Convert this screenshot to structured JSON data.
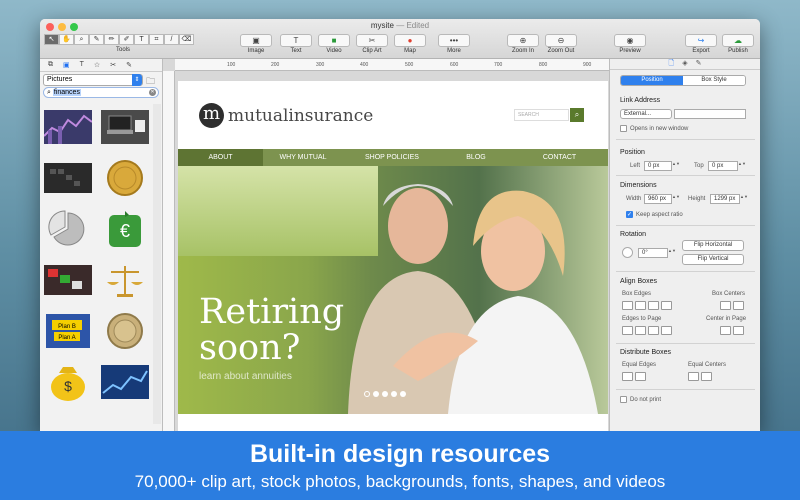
{
  "window": {
    "title": "mysite",
    "edited": "— Edited",
    "traffic_lights": [
      "#fc605b",
      "#fdbc40",
      "#34c84a"
    ]
  },
  "toolbar": {
    "tools_label": "Tools",
    "buttons": [
      {
        "label": "Image",
        "icon": "image-icon"
      },
      {
        "label": "Text",
        "icon": "text-icon"
      },
      {
        "label": "Video",
        "icon": "video-icon"
      },
      {
        "label": "Clip Art",
        "icon": "clipart-icon"
      },
      {
        "label": "Map",
        "icon": "map-pin-icon"
      },
      {
        "label": "More",
        "icon": "more-icon"
      },
      {
        "label": "Zoom In",
        "icon": "zoom-in-icon"
      },
      {
        "label": "Zoom Out",
        "icon": "zoom-out-icon"
      },
      {
        "label": "Preview",
        "icon": "eye-icon"
      },
      {
        "label": "Export",
        "icon": "export-icon"
      },
      {
        "label": "Publish",
        "icon": "publish-icon"
      }
    ]
  },
  "library": {
    "category": "Pictures",
    "search_value": "finances",
    "items": [
      "stock-chart",
      "laptop-desk",
      "calculator-keys",
      "gold-coin",
      "pie-chart-3d",
      "euro-safe",
      "typewriter-keys",
      "golden-scales",
      "plan-b-sign",
      "silver-coin",
      "profit-money-bag",
      "stock-arrow"
    ]
  },
  "ruler": {
    "labels": [
      "100",
      "200",
      "300",
      "400",
      "500",
      "600",
      "700",
      "800",
      "900"
    ]
  },
  "site": {
    "logo_letter": "m",
    "logo_bold": "mutual",
    "logo_rest": "insurance",
    "search_placeholder": "SEARCH",
    "nav": [
      "ABOUT",
      "WHY MUTUAL",
      "SHOP POLICIES",
      "BLOG",
      "CONTACT"
    ],
    "hero_title_1": "Retiring",
    "hero_title_2": "soon?",
    "hero_sub": "learn about annuities",
    "slide_active_index": 0,
    "slide_count": 5
  },
  "inspector": {
    "tab_position": "Position",
    "tab_box_style": "Box Style",
    "link_address": "Link Address",
    "link_type": "External...",
    "open_new_window": "Opens in new window",
    "position": "Position",
    "left_label": "Left",
    "left_value": "0 px",
    "top_label": "Top",
    "top_value": "0 px",
    "dimensions": "Dimensions",
    "width_label": "Width",
    "width_value": "960 px",
    "height_label": "Height",
    "height_value": "1299 px",
    "keep_aspect": "Keep aspect ratio",
    "rotation": "Rotation",
    "rotation_value": "0°",
    "flip_h": "Flip Horizontal",
    "flip_v": "Flip Vertical",
    "align_boxes": "Align Boxes",
    "box_edges": "Box Edges",
    "box_centers": "Box Centers",
    "edges_to_page": "Edges to Page",
    "center_in_page": "Center in Page",
    "distribute_boxes": "Distribute Boxes",
    "equal_edges": "Equal Edges",
    "equal_centers": "Equal Centers",
    "do_not_print": "Do not print"
  },
  "banner": {
    "headline": "Built-in design resources",
    "subline": "70,000+ clip art, stock photos, backgrounds, fonts, shapes, and videos"
  }
}
